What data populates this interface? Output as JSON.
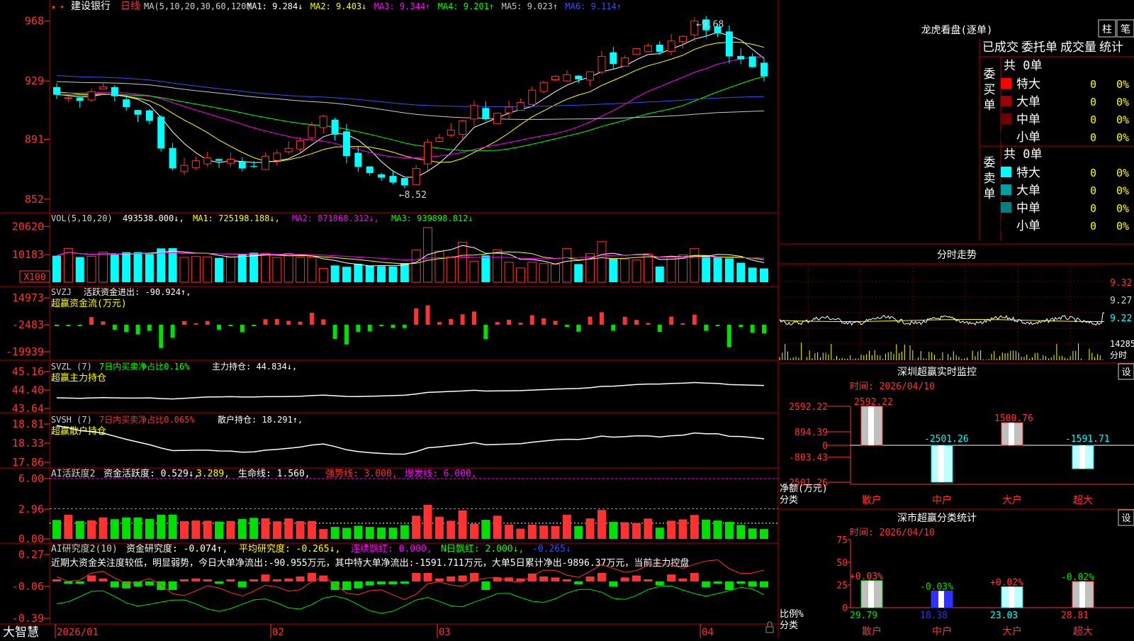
{
  "app_name": "大智慧",
  "dates": [
    "2026/01",
    "02",
    "03",
    "04"
  ],
  "main": {
    "stock_name": "建设银行",
    "period": "日线",
    "ma_params": "MA(5,10,20,30,60,120)",
    "ma_labels": [
      "MA1: 9.284↓",
      "MA2: 9.403↓",
      "MA3: 9.344↑",
      "MA4: 9.201↑",
      "MA5: 9.023↑",
      "MA6: 9.114↑"
    ],
    "ma_colors": [
      "#ffffff",
      "#ffff00",
      "#ff00ff",
      "#00ff00",
      "#c8c8c8",
      "#3050ff"
    ],
    "y_ticks": [
      "968",
      "929",
      "891",
      "852"
    ],
    "high_label": "9.68",
    "low_label": "8.52"
  },
  "volume": {
    "header": "VOL(5,10,20)",
    "value": "493538.000↓,",
    "ma1": "MA1: 725198.188↓,",
    "ma2": "MA2: 871868.312↓,",
    "ma3": "MA3: 939898.812↓",
    "y_ticks": [
      "20620",
      "10183"
    ],
    "unit": "X100"
  },
  "svzj": {
    "header": "SVZJ",
    "label": "活跃资金进出: -90.924↑,",
    "sub": "超赢资金流(万元)",
    "y_ticks": [
      "14973",
      "-2483",
      "-19939"
    ]
  },
  "svzl": {
    "header": "SVZL (7)",
    "label1": "7日内买卖净占比0.16%",
    "label2": "主力持仓: 44.834↓,",
    "sub": "超赢主力持仓",
    "y_ticks": [
      "45.16",
      "44.40",
      "43.64"
    ]
  },
  "svsh": {
    "header": "SVSH (7)",
    "label1": "7日内买卖净占比0.065%",
    "label2": "散户持仓: 18.291↑,",
    "sub": "超赢散户持仓",
    "y_ticks": [
      "18.81",
      "18.33",
      "17.86"
    ]
  },
  "ai1": {
    "header": "AI活跃度2",
    "label1": "资金活跃度: 0.529↓,",
    "label2": "3.289,",
    "label3": "生命线: 1.560,",
    "label4": "强势线: 3.000,",
    "label5": "爆发线: 6.000,",
    "y_ticks": [
      "6.00",
      "2.96",
      "0.00"
    ]
  },
  "ai2": {
    "header": "AI研究度2(10)",
    "label1": "资金研究度: -0.074↑,",
    "label2": "平均研究度: -0.265↓,",
    "label3": "连续飘红: 0.000,",
    "label4": "N日飘红: 2.000↓,",
    "label5": "-0.265↓",
    "comment": "近期大资金关注度较低，明显弱势，今日大单净流出:-90.955万元，其中特大单净流出:-1591.711万元，大单5日累计净出-9896.37万元，当前主力控盘",
    "y_ticks": [
      "0.27",
      "-0.06",
      "-0.39"
    ]
  },
  "right": {
    "lhb_title": "龙虎看盘(逐单)",
    "btn_bar": "柱",
    "btn_pen": "笔",
    "tabs": [
      "已成交",
      "委托单",
      "成交量",
      "统计"
    ],
    "buy_label": "委买单",
    "sell_label": "委卖单",
    "buy_total": "共 0单",
    "sell_total": "共 0单",
    "buy_rows": [
      {
        "name": "特大",
        "count": "0",
        "pct": "0%",
        "color": "#ff0000"
      },
      {
        "name": "大单",
        "count": "0",
        "pct": "0%",
        "color": "#a00000"
      },
      {
        "name": "中单",
        "count": "0",
        "pct": "0%",
        "color": "#700000"
      },
      {
        "name": "小单",
        "count": "0",
        "pct": "0%",
        "color": "#000000"
      }
    ],
    "sell_rows": [
      {
        "name": "特大",
        "count": "0",
        "pct": "0%",
        "color": "#00ffff"
      },
      {
        "name": "大单",
        "count": "0",
        "pct": "0%",
        "color": "#00a0a0"
      },
      {
        "name": "中单",
        "count": "0",
        "pct": "0%",
        "color": "#008080"
      },
      {
        "name": "小单",
        "count": "0",
        "pct": "0%",
        "color": "#000000"
      }
    ],
    "minute_title": "分时走势",
    "minute_prices": [
      "9.32",
      "9.27",
      "9.22"
    ],
    "minute_vol": "14285",
    "minute_vol_label": "分时",
    "monitor_title": "深圳超赢实时监控",
    "settings_label": "设",
    "monitor_time": "时间: 2026/04/10",
    "monitor_y": [
      "2592.22",
      "894.39",
      "0",
      "-803.43",
      "-2501.26"
    ],
    "monitor_ylabel1": "净额(万元)",
    "monitor_ylabel2": "分类",
    "dist_title": "深市超赢分类统计",
    "dist_time": "时间: 2026/04/10",
    "dist_y": [
      "75",
      "50",
      "25",
      "0"
    ],
    "dist_ylabel1": "比例%",
    "dist_ylabel2": "分类"
  },
  "chart_data": [
    {
      "type": "bar",
      "title": "深圳超赢实时监控",
      "ylabel": "净额(万元)",
      "categories": [
        "散户",
        "中户",
        "大户",
        "超大"
      ],
      "values": [
        2592.22,
        -2501.26,
        1500.76,
        -1591.71
      ],
      "ylim": [
        -2501.26,
        2592.22
      ]
    },
    {
      "type": "bar",
      "title": "深市超赢分类统计",
      "ylabel": "比例%",
      "categories": [
        "散户",
        "中户",
        "大户",
        "超大"
      ],
      "values": [
        29.79,
        18.38,
        23.03,
        28.81
      ],
      "changes": [
        "+0.03%",
        "-0.03%",
        "+0.02%",
        "-0.02%"
      ],
      "ylim": [
        0,
        75
      ]
    },
    {
      "type": "line",
      "title": "建设银行 日线",
      "series": [
        {
          "name": "close",
          "values": [
            9.2,
            9.18,
            9.16,
            9.22,
            9.25,
            9.19,
            9.12,
            9.07,
            9.03,
            8.85,
            8.72,
            8.74,
            8.77,
            8.79,
            8.77,
            8.78,
            8.72,
            8.73,
            8.8,
            8.82,
            8.85,
            8.9,
            9.0,
            9.06,
            8.94,
            8.8,
            8.73,
            8.69,
            8.66,
            8.63,
            8.61,
            8.72,
            8.89,
            8.92,
            8.97,
            9.03,
            9.13,
            9.04,
            9.08,
            9.12,
            9.15,
            9.23,
            9.28,
            9.32,
            9.33,
            9.3,
            9.35,
            9.45,
            9.4,
            9.44,
            9.5,
            9.52,
            9.48,
            9.55,
            9.58,
            9.68,
            9.62,
            9.6,
            9.45,
            9.43,
            9.38,
            9.32
          ]
        }
      ]
    },
    {
      "type": "bar",
      "title": "VOL(5,10,20)",
      "series": [
        {
          "name": "VOL",
          "values": [
            9800,
            12500,
            9300,
            9600,
            11100,
            10200,
            11100,
            11100,
            10400,
            12500,
            12600,
            9200,
            9500,
            9400,
            9000,
            9300,
            10300,
            10900,
            10700,
            9100,
            10600,
            9200,
            9300,
            5100,
            6200,
            5700,
            6800,
            6200,
            5900,
            5800,
            7100,
            12000,
            20200,
            11500,
            9400,
            14800,
            7800,
            9900,
            12000,
            7400,
            5300,
            7400,
            6900,
            6700,
            12500,
            6700,
            10600,
            15000,
            8800,
            8600,
            8200,
            10500,
            5800,
            9400,
            10100,
            12400,
            10000,
            9500,
            8800,
            7200,
            5400,
            5100
          ]
        }
      ]
    }
  ]
}
